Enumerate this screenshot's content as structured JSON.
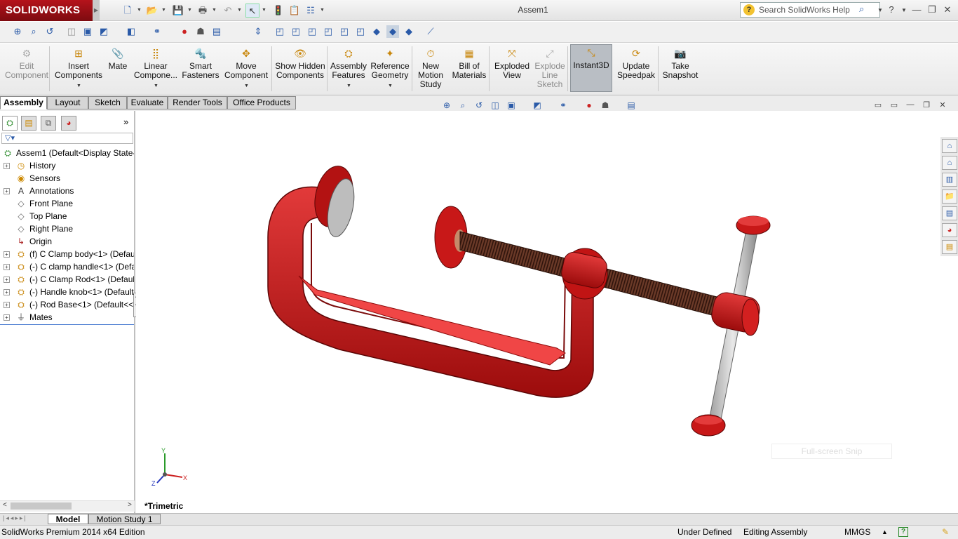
{
  "app": {
    "logo": "SOLIDWORKS",
    "window_title": "Assem1",
    "search_placeholder": "Search SolidWorks Help"
  },
  "command_manager": {
    "buttons": [
      {
        "label": "Edit Component",
        "icon": "edit-component-icon",
        "enabled": false
      },
      {
        "label": "Insert Components",
        "icon": "insert-components-icon",
        "enabled": true
      },
      {
        "label": "Mate",
        "icon": "mate-icon",
        "enabled": true
      },
      {
        "label": "Linear Compone...",
        "icon": "linear-pattern-icon",
        "enabled": true
      },
      {
        "label": "Smart Fasteners",
        "icon": "smart-fasteners-icon",
        "enabled": true
      },
      {
        "label": "Move Component",
        "icon": "move-component-icon",
        "enabled": true
      },
      {
        "label": "Show Hidden Components",
        "icon": "show-hidden-icon",
        "enabled": true
      },
      {
        "label": "Assembly Features",
        "icon": "assembly-features-icon",
        "enabled": true
      },
      {
        "label": "Reference Geometry",
        "icon": "reference-geometry-icon",
        "enabled": true
      },
      {
        "label": "New Motion Study",
        "icon": "motion-study-icon",
        "enabled": true
      },
      {
        "label": "Bill of Materials",
        "icon": "bom-icon",
        "enabled": true
      },
      {
        "label": "Exploded View",
        "icon": "exploded-view-icon",
        "enabled": true
      },
      {
        "label": "Explode Line Sketch",
        "icon": "explode-line-icon",
        "enabled": false
      },
      {
        "label": "Instant3D",
        "icon": "instant3d-icon",
        "enabled": true,
        "active": true
      },
      {
        "label": "Update Speedpak",
        "icon": "speedpak-icon",
        "enabled": true
      },
      {
        "label": "Take Snapshot",
        "icon": "snapshot-icon",
        "enabled": true
      }
    ]
  },
  "tabs": [
    "Assembly",
    "Layout",
    "Sketch",
    "Evaluate",
    "Render Tools",
    "Office Products"
  ],
  "active_tab": "Assembly",
  "tree": {
    "root": "Assem1  (Default<Display State-",
    "items": [
      {
        "label": "History",
        "icon": "history-icon",
        "expandable": true
      },
      {
        "label": "Sensors",
        "icon": "sensors-icon",
        "expandable": false
      },
      {
        "label": "Annotations",
        "icon": "annotations-icon",
        "expandable": true
      },
      {
        "label": "Front Plane",
        "icon": "plane-icon",
        "expandable": false
      },
      {
        "label": "Top Plane",
        "icon": "plane-icon",
        "expandable": false
      },
      {
        "label": "Right Plane",
        "icon": "plane-icon",
        "expandable": false
      },
      {
        "label": "Origin",
        "icon": "origin-icon",
        "expandable": false
      },
      {
        "label": "(f) C Clamp body<1> (Defau",
        "icon": "part-icon",
        "expandable": true
      },
      {
        "label": "(-) C clamp handle<1> (Defa",
        "icon": "part-icon",
        "expandable": true
      },
      {
        "label": "(-) C Clamp Rod<1> (Defaul",
        "icon": "part-icon",
        "expandable": true
      },
      {
        "label": "(-) Handle knob<1> (Default",
        "icon": "part-icon",
        "expandable": true
      },
      {
        "label": "(-) Rod Base<1> (Default<<I",
        "icon": "part-icon",
        "expandable": true
      },
      {
        "label": "Mates",
        "icon": "mates-icon",
        "expandable": true
      }
    ]
  },
  "graphics": {
    "view_label": "*Trimetric",
    "snip_text": "Full-screen Snip",
    "axis": {
      "x": "X",
      "y": "Y",
      "z": "Z"
    }
  },
  "bottom_tabs": [
    "Model",
    "Motion Study 1"
  ],
  "status": {
    "product": "SolidWorks Premium 2014 x64 Edition",
    "definition": "Under Defined",
    "mode": "Editing Assembly",
    "units": "MMGS"
  },
  "colors": {
    "brand": "#a3121a",
    "part": "#d41818",
    "accent": "#2a5aa8"
  }
}
